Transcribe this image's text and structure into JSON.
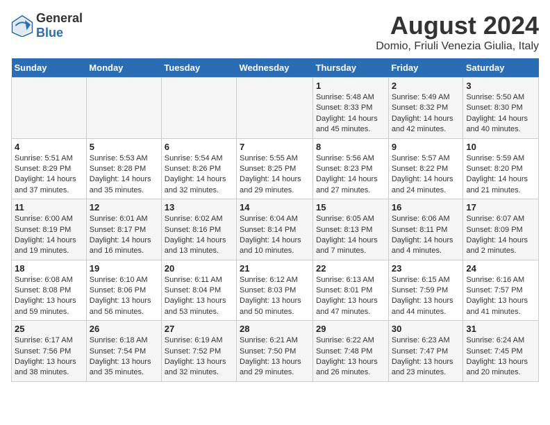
{
  "header": {
    "logo_general": "General",
    "logo_blue": "Blue",
    "main_title": "August 2024",
    "subtitle": "Domio, Friuli Venezia Giulia, Italy"
  },
  "days_of_week": [
    "Sunday",
    "Monday",
    "Tuesday",
    "Wednesday",
    "Thursday",
    "Friday",
    "Saturday"
  ],
  "weeks": [
    [
      {
        "day": "",
        "sunrise": "",
        "sunset": "",
        "daylight": ""
      },
      {
        "day": "",
        "sunrise": "",
        "sunset": "",
        "daylight": ""
      },
      {
        "day": "",
        "sunrise": "",
        "sunset": "",
        "daylight": ""
      },
      {
        "day": "",
        "sunrise": "",
        "sunset": "",
        "daylight": ""
      },
      {
        "day": "1",
        "sunrise": "Sunrise: 5:48 AM",
        "sunset": "Sunset: 8:33 PM",
        "daylight": "Daylight: 14 hours and 45 minutes."
      },
      {
        "day": "2",
        "sunrise": "Sunrise: 5:49 AM",
        "sunset": "Sunset: 8:32 PM",
        "daylight": "Daylight: 14 hours and 42 minutes."
      },
      {
        "day": "3",
        "sunrise": "Sunrise: 5:50 AM",
        "sunset": "Sunset: 8:30 PM",
        "daylight": "Daylight: 14 hours and 40 minutes."
      }
    ],
    [
      {
        "day": "4",
        "sunrise": "Sunrise: 5:51 AM",
        "sunset": "Sunset: 8:29 PM",
        "daylight": "Daylight: 14 hours and 37 minutes."
      },
      {
        "day": "5",
        "sunrise": "Sunrise: 5:53 AM",
        "sunset": "Sunset: 8:28 PM",
        "daylight": "Daylight: 14 hours and 35 minutes."
      },
      {
        "day": "6",
        "sunrise": "Sunrise: 5:54 AM",
        "sunset": "Sunset: 8:26 PM",
        "daylight": "Daylight: 14 hours and 32 minutes."
      },
      {
        "day": "7",
        "sunrise": "Sunrise: 5:55 AM",
        "sunset": "Sunset: 8:25 PM",
        "daylight": "Daylight: 14 hours and 29 minutes."
      },
      {
        "day": "8",
        "sunrise": "Sunrise: 5:56 AM",
        "sunset": "Sunset: 8:23 PM",
        "daylight": "Daylight: 14 hours and 27 minutes."
      },
      {
        "day": "9",
        "sunrise": "Sunrise: 5:57 AM",
        "sunset": "Sunset: 8:22 PM",
        "daylight": "Daylight: 14 hours and 24 minutes."
      },
      {
        "day": "10",
        "sunrise": "Sunrise: 5:59 AM",
        "sunset": "Sunset: 8:20 PM",
        "daylight": "Daylight: 14 hours and 21 minutes."
      }
    ],
    [
      {
        "day": "11",
        "sunrise": "Sunrise: 6:00 AM",
        "sunset": "Sunset: 8:19 PM",
        "daylight": "Daylight: 14 hours and 19 minutes."
      },
      {
        "day": "12",
        "sunrise": "Sunrise: 6:01 AM",
        "sunset": "Sunset: 8:17 PM",
        "daylight": "Daylight: 14 hours and 16 minutes."
      },
      {
        "day": "13",
        "sunrise": "Sunrise: 6:02 AM",
        "sunset": "Sunset: 8:16 PM",
        "daylight": "Daylight: 14 hours and 13 minutes."
      },
      {
        "day": "14",
        "sunrise": "Sunrise: 6:04 AM",
        "sunset": "Sunset: 8:14 PM",
        "daylight": "Daylight: 14 hours and 10 minutes."
      },
      {
        "day": "15",
        "sunrise": "Sunrise: 6:05 AM",
        "sunset": "Sunset: 8:13 PM",
        "daylight": "Daylight: 14 hours and 7 minutes."
      },
      {
        "day": "16",
        "sunrise": "Sunrise: 6:06 AM",
        "sunset": "Sunset: 8:11 PM",
        "daylight": "Daylight: 14 hours and 4 minutes."
      },
      {
        "day": "17",
        "sunrise": "Sunrise: 6:07 AM",
        "sunset": "Sunset: 8:09 PM",
        "daylight": "Daylight: 14 hours and 2 minutes."
      }
    ],
    [
      {
        "day": "18",
        "sunrise": "Sunrise: 6:08 AM",
        "sunset": "Sunset: 8:08 PM",
        "daylight": "Daylight: 13 hours and 59 minutes."
      },
      {
        "day": "19",
        "sunrise": "Sunrise: 6:10 AM",
        "sunset": "Sunset: 8:06 PM",
        "daylight": "Daylight: 13 hours and 56 minutes."
      },
      {
        "day": "20",
        "sunrise": "Sunrise: 6:11 AM",
        "sunset": "Sunset: 8:04 PM",
        "daylight": "Daylight: 13 hours and 53 minutes."
      },
      {
        "day": "21",
        "sunrise": "Sunrise: 6:12 AM",
        "sunset": "Sunset: 8:03 PM",
        "daylight": "Daylight: 13 hours and 50 minutes."
      },
      {
        "day": "22",
        "sunrise": "Sunrise: 6:13 AM",
        "sunset": "Sunset: 8:01 PM",
        "daylight": "Daylight: 13 hours and 47 minutes."
      },
      {
        "day": "23",
        "sunrise": "Sunrise: 6:15 AM",
        "sunset": "Sunset: 7:59 PM",
        "daylight": "Daylight: 13 hours and 44 minutes."
      },
      {
        "day": "24",
        "sunrise": "Sunrise: 6:16 AM",
        "sunset": "Sunset: 7:57 PM",
        "daylight": "Daylight: 13 hours and 41 minutes."
      }
    ],
    [
      {
        "day": "25",
        "sunrise": "Sunrise: 6:17 AM",
        "sunset": "Sunset: 7:56 PM",
        "daylight": "Daylight: 13 hours and 38 minutes."
      },
      {
        "day": "26",
        "sunrise": "Sunrise: 6:18 AM",
        "sunset": "Sunset: 7:54 PM",
        "daylight": "Daylight: 13 hours and 35 minutes."
      },
      {
        "day": "27",
        "sunrise": "Sunrise: 6:19 AM",
        "sunset": "Sunset: 7:52 PM",
        "daylight": "Daylight: 13 hours and 32 minutes."
      },
      {
        "day": "28",
        "sunrise": "Sunrise: 6:21 AM",
        "sunset": "Sunset: 7:50 PM",
        "daylight": "Daylight: 13 hours and 29 minutes."
      },
      {
        "day": "29",
        "sunrise": "Sunrise: 6:22 AM",
        "sunset": "Sunset: 7:48 PM",
        "daylight": "Daylight: 13 hours and 26 minutes."
      },
      {
        "day": "30",
        "sunrise": "Sunrise: 6:23 AM",
        "sunset": "Sunset: 7:47 PM",
        "daylight": "Daylight: 13 hours and 23 minutes."
      },
      {
        "day": "31",
        "sunrise": "Sunrise: 6:24 AM",
        "sunset": "Sunset: 7:45 PM",
        "daylight": "Daylight: 13 hours and 20 minutes."
      }
    ]
  ]
}
